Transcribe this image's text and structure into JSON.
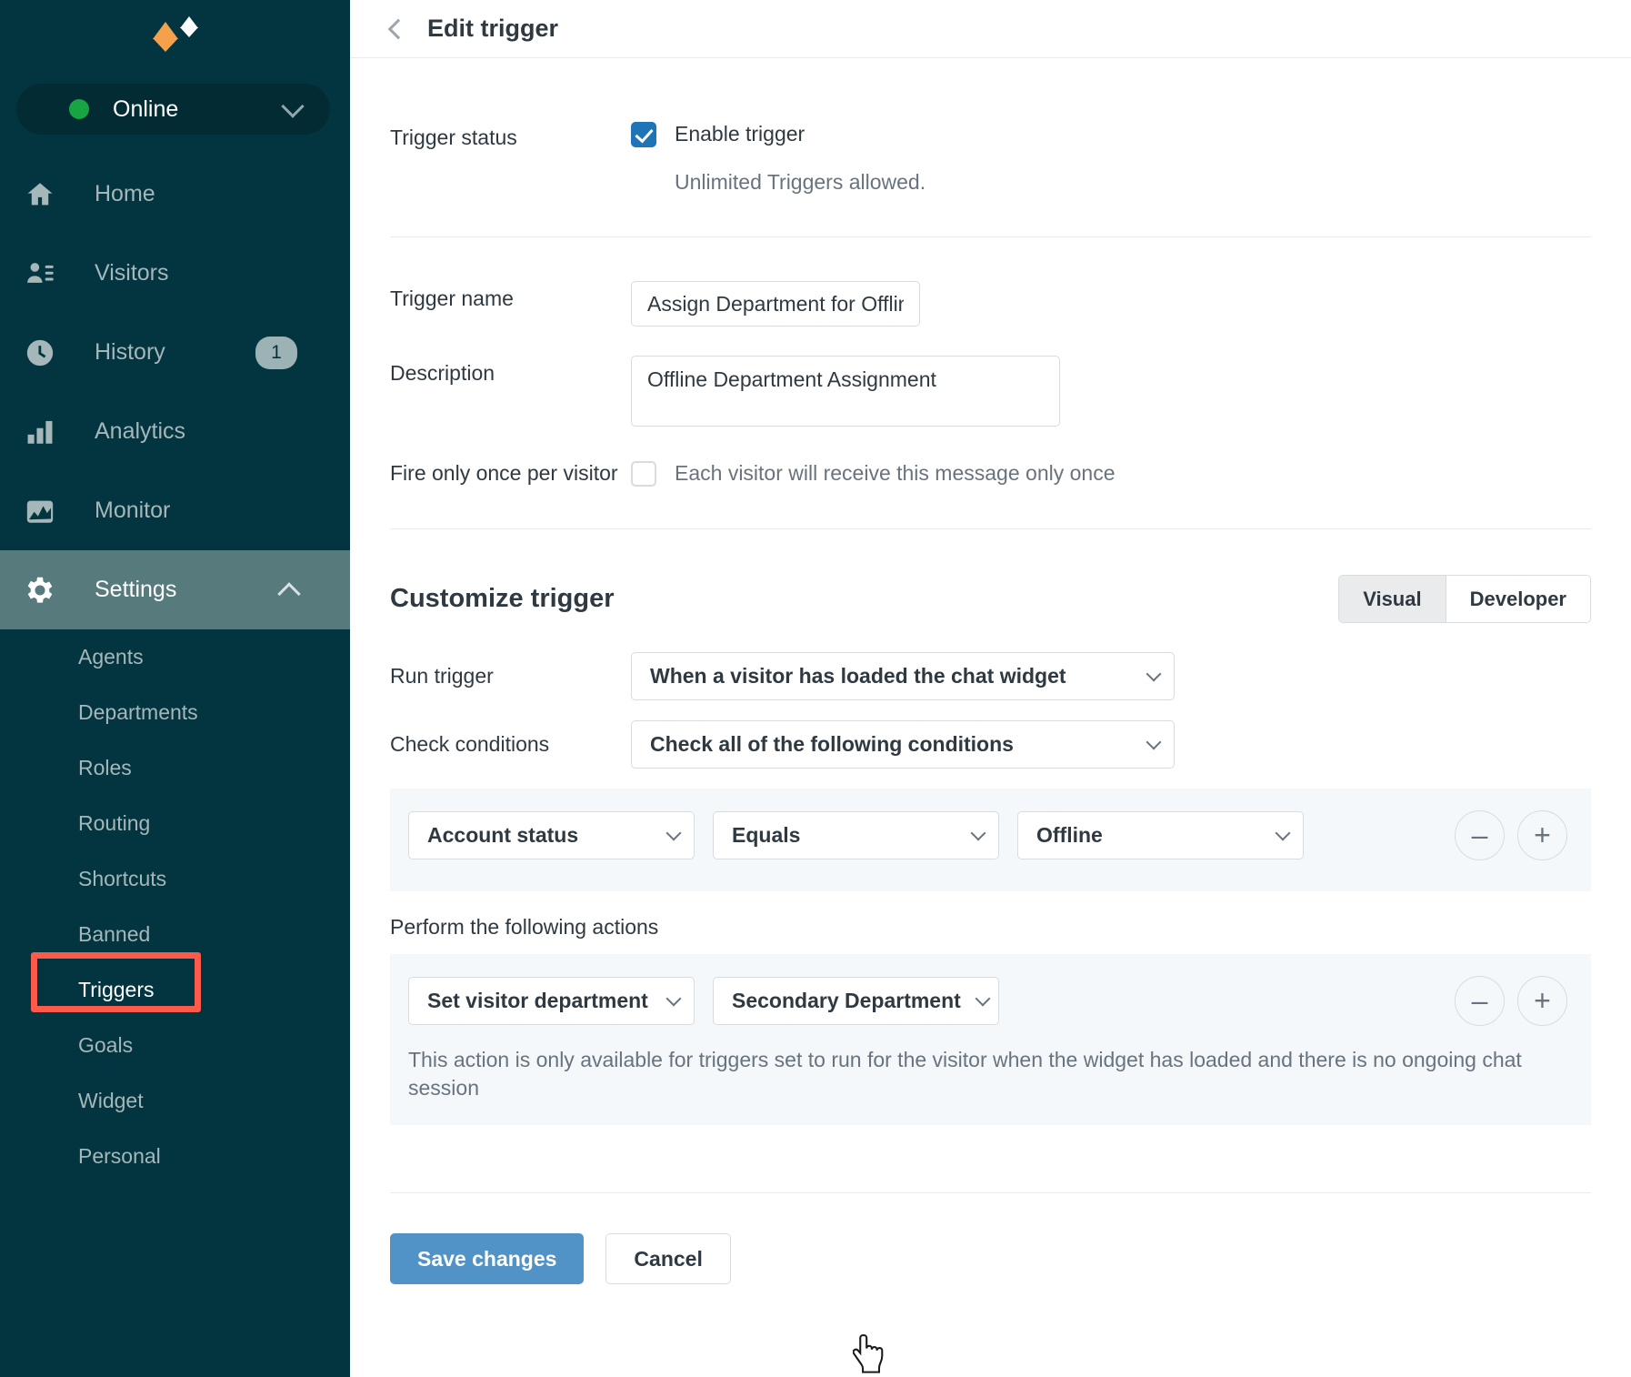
{
  "sidebar": {
    "logo_name": "zendesk-chat-logo",
    "status": {
      "label": "Online",
      "dot_color": "#17A543",
      "chevron": "chevron-down-icon"
    },
    "nav": [
      {
        "id": "home",
        "label": "Home",
        "icon": "home-icon"
      },
      {
        "id": "visitors",
        "label": "Visitors",
        "icon": "visitors-icon"
      },
      {
        "id": "history",
        "label": "History",
        "icon": "clock-icon",
        "badge": "1"
      },
      {
        "id": "analytics",
        "label": "Analytics",
        "icon": "bar-chart-icon"
      },
      {
        "id": "monitor",
        "label": "Monitor",
        "icon": "monitor-icon"
      },
      {
        "id": "settings",
        "label": "Settings",
        "icon": "gear-icon",
        "active": true,
        "chevron": "chevron-up-icon"
      }
    ],
    "subnav": [
      {
        "id": "agents",
        "label": "Agents"
      },
      {
        "id": "departments",
        "label": "Departments"
      },
      {
        "id": "roles",
        "label": "Roles"
      },
      {
        "id": "routing",
        "label": "Routing"
      },
      {
        "id": "shortcuts",
        "label": "Shortcuts"
      },
      {
        "id": "banned",
        "label": "Banned"
      },
      {
        "id": "triggers",
        "label": "Triggers",
        "selected": true,
        "highlighted": true
      },
      {
        "id": "goals",
        "label": "Goals"
      },
      {
        "id": "widget",
        "label": "Widget"
      },
      {
        "id": "personal",
        "label": "Personal"
      }
    ],
    "colors": {
      "background": "#033540",
      "active_item": "#577A7C",
      "pill_background": "#022B34",
      "highlight_outline": "#FC5A4B"
    }
  },
  "header": {
    "back_icon": "chevron-left-icon",
    "title": "Edit trigger"
  },
  "form": {
    "trigger_status": {
      "label": "Trigger status",
      "checkbox_label": "Enable trigger",
      "checked": true,
      "helper": "Unlimited Triggers allowed."
    },
    "trigger_name": {
      "label": "Trigger name",
      "value": "Assign Department for Offline"
    },
    "description": {
      "label": "Description",
      "value": "Offline Department Assignment"
    },
    "fire_once": {
      "label": "Fire only once per visitor",
      "checked": false,
      "note": "Each visitor will receive this message only once"
    }
  },
  "customize": {
    "heading": "Customize trigger",
    "mode_toggle": {
      "options": [
        "Visual",
        "Developer"
      ],
      "selected": "Visual"
    },
    "run_trigger": {
      "label": "Run trigger",
      "value": "When a visitor has loaded the chat widget"
    },
    "check_conditions": {
      "label": "Check conditions",
      "value": "Check all of the following conditions"
    },
    "conditions": [
      {
        "field": "Account status",
        "operator": "Equals",
        "value": "Offline",
        "remove_label": "–",
        "add_label": "+"
      }
    ],
    "actions_title": "Perform the following actions",
    "actions": [
      {
        "action": "Set visitor department",
        "target": "Secondary Department",
        "note": "This action is only available for triggers set to run for the visitor when the widget has loaded and there is no ongoing chat session",
        "remove_label": "–",
        "add_label": "+"
      }
    ]
  },
  "footer": {
    "save_label": "Save changes",
    "cancel_label": "Cancel",
    "save_color": "#5293C7"
  }
}
